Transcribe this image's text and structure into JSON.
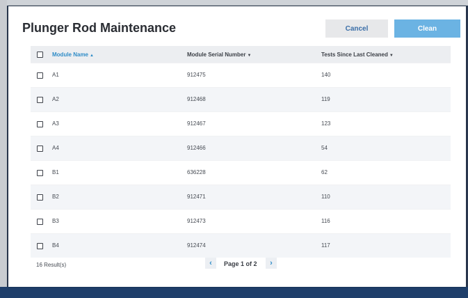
{
  "dialog": {
    "title": "Plunger Rod Maintenance",
    "cancel_label": "Cancel",
    "clean_label": "Clean"
  },
  "table": {
    "columns": [
      {
        "label": "Module Name",
        "sort_arrow": "▲"
      },
      {
        "label": "Module Serial Number",
        "sort_arrow": "▼"
      },
      {
        "label": "Tests Since Last Cleaned",
        "sort_arrow": "▼"
      }
    ],
    "rows": [
      {
        "name": "A1",
        "serial": "912475",
        "tests": "140"
      },
      {
        "name": "A2",
        "serial": "912468",
        "tests": "119"
      },
      {
        "name": "A3",
        "serial": "912467",
        "tests": "123"
      },
      {
        "name": "A4",
        "serial": "912466",
        "tests": "54"
      },
      {
        "name": "B1",
        "serial": "636228",
        "tests": "62"
      },
      {
        "name": "B2",
        "serial": "912471",
        "tests": "110"
      },
      {
        "name": "B3",
        "serial": "912473",
        "tests": "116"
      },
      {
        "name": "B4",
        "serial": "912474",
        "tests": "117"
      }
    ]
  },
  "footer": {
    "results_text": "16 Result(s)",
    "page_text": "Page 1 of 2",
    "prev_icon": "‹",
    "next_icon": "›"
  },
  "colors": {
    "accent": "#2f8cc7",
    "primary_button": "#6bb3e3",
    "row_alt": "#f3f5f8",
    "header_bg": "#eceef1"
  }
}
